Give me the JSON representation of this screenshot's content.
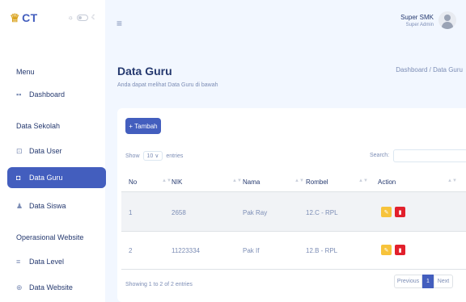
{
  "brand": {
    "logo": "CT",
    "logo_mark": "♕"
  },
  "theme": {
    "sun": "☼",
    "moon": "☾"
  },
  "sidebar": {
    "menu_title": "Menu",
    "data_sekolah_title": "Data Sekolah",
    "operasional_title": "Operasional Website",
    "items": [
      {
        "label": "Dashboard",
        "icon": "grid-icon",
        "glyph": "▪▪"
      },
      {
        "label": "Data User",
        "icon": "user-icon",
        "glyph": "⊡"
      },
      {
        "label": "Data Guru",
        "icon": "chat-icon",
        "glyph": "◘"
      },
      {
        "label": "Data Siswa",
        "icon": "people-icon",
        "glyph": "♟"
      },
      {
        "label": "Data Level",
        "icon": "layers-icon",
        "glyph": "≡"
      },
      {
        "label": "Data Website",
        "icon": "globe-icon",
        "glyph": "⊕"
      }
    ]
  },
  "header": {
    "menu_glyph": "≡",
    "user_name": "Super SMK",
    "user_role": "Super Admin"
  },
  "page": {
    "title": "Data Guru",
    "subtitle": "Anda dapat melihat Data Guru di bawah",
    "breadcrumb": "Dashboard / Data Guru"
  },
  "toolbar": {
    "add_label": "+ Tambah"
  },
  "table_controls": {
    "show_label": "Show",
    "entries_value": "10 ∨",
    "entries_label": "entries",
    "search_label": "Search:",
    "search_value": ""
  },
  "table": {
    "columns": [
      "No",
      "NIK",
      "Nama",
      "Rombel",
      "Action"
    ],
    "sort_glyph": "▲▼",
    "rows": [
      {
        "no": "1",
        "nik": "2658",
        "nama": "Pak Ray",
        "rombel": "12.C - RPL"
      },
      {
        "no": "2",
        "nik": "11223334",
        "nama": "Pak If",
        "rombel": "12.B - RPL"
      }
    ],
    "edit_glyph": "✎",
    "delete_glyph": "▮"
  },
  "footer": {
    "info": "Showing 1 to 2 of 2 entries",
    "prev": "Previous",
    "page": "1",
    "next": "Next"
  },
  "colors": {
    "accent": "#435ebe",
    "edit": "#f7c33b",
    "delete": "#e2202c",
    "background": "#f2f7ff"
  }
}
